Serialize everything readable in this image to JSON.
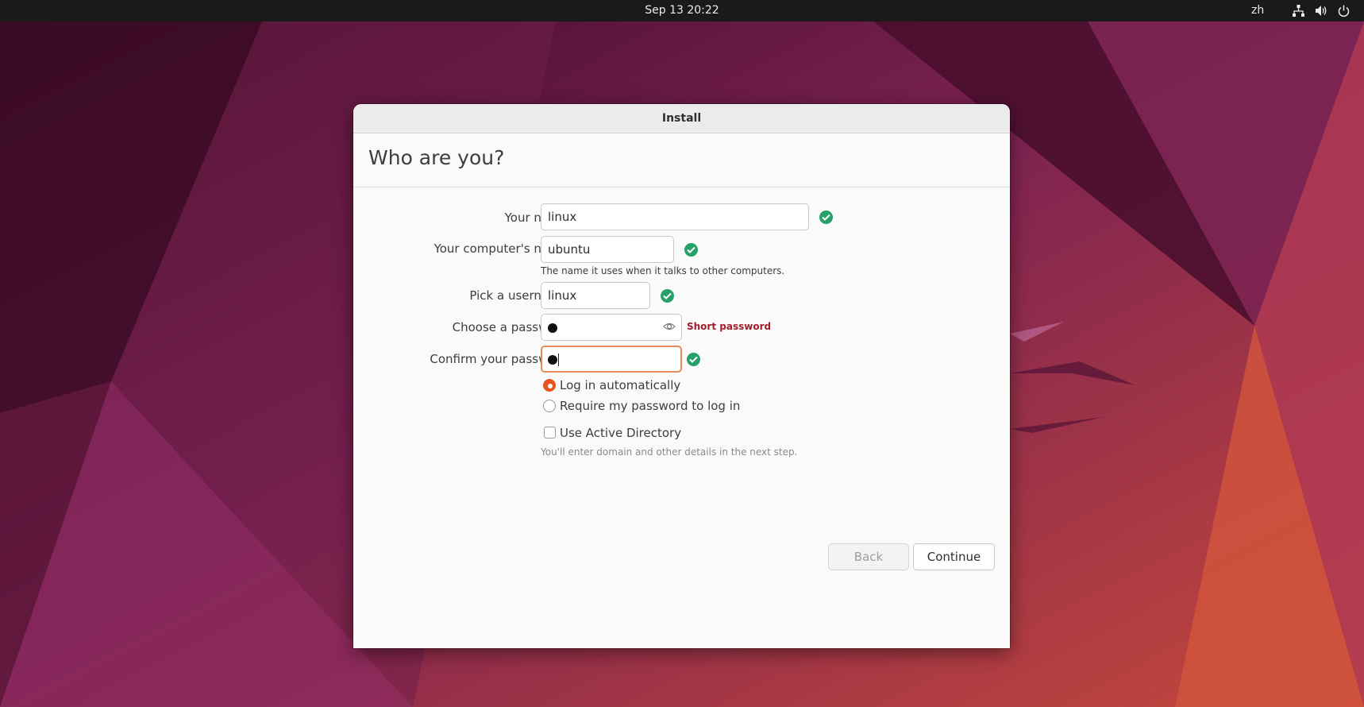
{
  "topbar": {
    "datetime": "Sep 13  20:22",
    "language": "zh",
    "icons": [
      "network-icon",
      "volume-icon",
      "power-icon"
    ]
  },
  "window": {
    "title": "Install",
    "heading": "Who are you?"
  },
  "form": {
    "name_label": "Your name:",
    "name_value": "linux",
    "computer_label": "Your computer's name:",
    "computer_value": "ubuntu",
    "computer_hint": "The name it uses when it talks to other computers.",
    "username_label": "Pick a username:",
    "username_value": "linux",
    "password_label": "Choose a password:",
    "password_warning": "Short password",
    "confirm_label": "Confirm your password:",
    "login_auto_label": "Log in automatically",
    "login_auto_selected": true,
    "login_require_label": "Require my password to log in",
    "login_require_selected": false,
    "active_directory_label": "Use Active Directory",
    "active_directory_checked": false,
    "active_directory_hint": "You'll enter domain and other details in the next step."
  },
  "buttons": {
    "back_label": "Back",
    "continue_label": "Continue"
  },
  "colors": {
    "accent": "#e95420",
    "valid": "#26a269",
    "warning": "#a51d2d"
  }
}
